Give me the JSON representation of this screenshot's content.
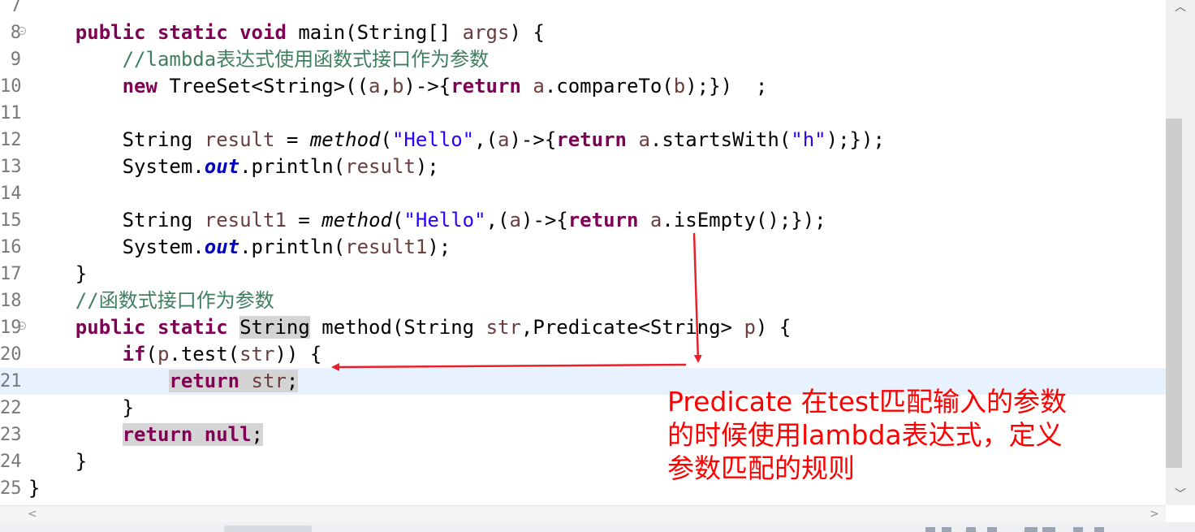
{
  "editor": {
    "lines": [
      {
        "num": "7",
        "fold": false,
        "current": false,
        "tokens": []
      },
      {
        "num": "8",
        "fold": true,
        "current": false,
        "tokens": [
          {
            "t": "    "
          },
          {
            "t": "public",
            "c": "kw"
          },
          {
            "t": " "
          },
          {
            "t": "static",
            "c": "kw"
          },
          {
            "t": " "
          },
          {
            "t": "void",
            "c": "kw"
          },
          {
            "t": " main(String[] "
          },
          {
            "t": "args",
            "c": "var"
          },
          {
            "t": ") {"
          }
        ]
      },
      {
        "num": "9",
        "fold": false,
        "current": false,
        "tokens": [
          {
            "t": "        "
          },
          {
            "t": "//lambda表达式使用函数式接口作为参数",
            "c": "cm"
          }
        ]
      },
      {
        "num": "10",
        "fold": false,
        "current": false,
        "tokens": [
          {
            "t": "        "
          },
          {
            "t": "new",
            "c": "kw"
          },
          {
            "t": " TreeSet<String>(("
          },
          {
            "t": "a",
            "c": "var"
          },
          {
            "t": ","
          },
          {
            "t": "b",
            "c": "var"
          },
          {
            "t": ")->{"
          },
          {
            "t": "return",
            "c": "kw"
          },
          {
            "t": " "
          },
          {
            "t": "a",
            "c": "var"
          },
          {
            "t": ".compareTo("
          },
          {
            "t": "b",
            "c": "var"
          },
          {
            "t": ");})  ;"
          }
        ]
      },
      {
        "num": "11",
        "fold": false,
        "current": false,
        "tokens": []
      },
      {
        "num": "12",
        "fold": false,
        "current": false,
        "tokens": [
          {
            "t": "        String "
          },
          {
            "t": "result",
            "c": "var"
          },
          {
            "t": " = "
          },
          {
            "t": "method",
            "c": "sm"
          },
          {
            "t": "("
          },
          {
            "t": "\"Hello\"",
            "c": "str"
          },
          {
            "t": ",("
          },
          {
            "t": "a",
            "c": "var"
          },
          {
            "t": ")->{"
          },
          {
            "t": "return",
            "c": "kw"
          },
          {
            "t": " "
          },
          {
            "t": "a",
            "c": "var"
          },
          {
            "t": ".startsWith("
          },
          {
            "t": "\"h\"",
            "c": "str"
          },
          {
            "t": ");});"
          }
        ]
      },
      {
        "num": "13",
        "fold": false,
        "current": false,
        "tokens": [
          {
            "t": "        System."
          },
          {
            "t": "out",
            "c": "fld"
          },
          {
            "t": ".println("
          },
          {
            "t": "result",
            "c": "var"
          },
          {
            "t": ");"
          }
        ]
      },
      {
        "num": "14",
        "fold": false,
        "current": false,
        "tokens": []
      },
      {
        "num": "15",
        "fold": false,
        "current": false,
        "tokens": [
          {
            "t": "        String "
          },
          {
            "t": "result1",
            "c": "var"
          },
          {
            "t": " = "
          },
          {
            "t": "method",
            "c": "sm"
          },
          {
            "t": "("
          },
          {
            "t": "\"Hello\"",
            "c": "str"
          },
          {
            "t": ",("
          },
          {
            "t": "a",
            "c": "var"
          },
          {
            "t": ")->{"
          },
          {
            "t": "return",
            "c": "kw"
          },
          {
            "t": " "
          },
          {
            "t": "a",
            "c": "var"
          },
          {
            "t": ".isEmpty();});"
          }
        ]
      },
      {
        "num": "16",
        "fold": false,
        "current": false,
        "tokens": [
          {
            "t": "        System."
          },
          {
            "t": "out",
            "c": "fld"
          },
          {
            "t": ".println("
          },
          {
            "t": "result1",
            "c": "var"
          },
          {
            "t": ");"
          }
        ]
      },
      {
        "num": "17",
        "fold": false,
        "current": false,
        "tokens": [
          {
            "t": "    }"
          }
        ]
      },
      {
        "num": "18",
        "fold": false,
        "current": false,
        "tokens": [
          {
            "t": "    "
          },
          {
            "t": "//函数式接口作为参数",
            "c": "cm"
          }
        ]
      },
      {
        "num": "19",
        "fold": true,
        "current": false,
        "tokens": [
          {
            "t": "    "
          },
          {
            "t": "public",
            "c": "kw"
          },
          {
            "t": " "
          },
          {
            "t": "static",
            "c": "kw"
          },
          {
            "t": " "
          },
          {
            "t": "String",
            "c": "hl"
          },
          {
            "t": " method(String "
          },
          {
            "t": "str",
            "c": "var"
          },
          {
            "t": ",Predicate<String> "
          },
          {
            "t": "p",
            "c": "var"
          },
          {
            "t": ") {"
          }
        ]
      },
      {
        "num": "20",
        "fold": false,
        "current": false,
        "tokens": [
          {
            "t": "        "
          },
          {
            "t": "if",
            "c": "kw"
          },
          {
            "t": "("
          },
          {
            "t": "p",
            "c": "var"
          },
          {
            "t": ".test("
          },
          {
            "t": "str",
            "c": "var"
          },
          {
            "t": ")) {"
          }
        ]
      },
      {
        "num": "21",
        "fold": false,
        "current": true,
        "tokens": [
          {
            "t": "            "
          },
          {
            "t": "return",
            "c": "kw hl"
          },
          {
            "t": " ",
            "c": "hl"
          },
          {
            "t": "str",
            "c": "var hl"
          },
          {
            "t": ";",
            "c": "hl"
          }
        ]
      },
      {
        "num": "22",
        "fold": false,
        "current": false,
        "tokens": [
          {
            "t": "        }"
          }
        ]
      },
      {
        "num": "23",
        "fold": false,
        "current": false,
        "tokens": [
          {
            "t": "        "
          },
          {
            "t": "return",
            "c": "kw hl"
          },
          {
            "t": " ",
            "c": "hl"
          },
          {
            "t": "null",
            "c": "kw hl"
          },
          {
            "t": ";",
            "c": "hl"
          }
        ]
      },
      {
        "num": "24",
        "fold": false,
        "current": false,
        "tokens": [
          {
            "t": "    }"
          }
        ]
      },
      {
        "num": "25",
        "fold": false,
        "current": false,
        "tokens": [
          {
            "t": "}"
          }
        ]
      }
    ]
  },
  "scrollbar": {
    "up_glyph": "︿",
    "down_glyph": "﹀",
    "left_glyph": "<",
    "right_glyph": ">"
  },
  "annotation": {
    "lines": [
      "Predicate 在test匹配输入的参数",
      "的时候使用lambda表达式，定义",
      "参数匹配的规则"
    ],
    "color": "#ff0000"
  }
}
